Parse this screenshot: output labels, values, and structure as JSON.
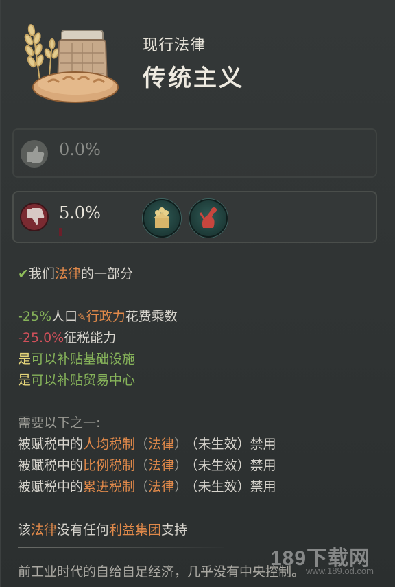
{
  "header": {
    "subtitle": "现行法律",
    "title": "传统主义"
  },
  "support": {
    "approve_value": "0.0%",
    "disapprove_value": "5.0%",
    "disapprove_groups": [
      "rural-folk-icon",
      "laborers-icon"
    ]
  },
  "status": {
    "part_of_prefix": "我们",
    "part_of_link": "法律",
    "part_of_suffix": "的一部分"
  },
  "effects": [
    {
      "value": "-25%",
      "text1": "人口",
      "link": "行政力",
      "text2": "花费乘数"
    },
    {
      "value": "-25.0%",
      "text": "征税能力"
    },
    {
      "yes": "是",
      "text": "可以补贴基础设施"
    },
    {
      "yes": "是",
      "text": "可以补贴贸易中心"
    }
  ],
  "requirements": {
    "heading": "需要以下之一:",
    "items": [
      {
        "pre": "被赋税",
        "mid": "中的",
        "law": "人均税制",
        "open": "（",
        "tag": "法律",
        "close": "）",
        "status": "（未生效）禁用"
      },
      {
        "pre": "被赋税",
        "mid": "中的",
        "law": "比例税制",
        "open": "（",
        "tag": "法律",
        "close": "）",
        "status": "（未生效）禁用"
      },
      {
        "pre": "被赋税",
        "mid": "中的",
        "law": "累进税制",
        "open": "（",
        "tag": "法律",
        "close": "）",
        "status": "（未生效）禁用"
      }
    ]
  },
  "interest": {
    "pre": "该",
    "law": "法律",
    "mid": "没有任何",
    "group": "利益集团",
    "post": "支持"
  },
  "footer": "前工业时代的自给自足经济，几乎没有中央控制。",
  "watermark": {
    "main": "189下载网",
    "sub": "www.189.od.com"
  },
  "colors": {
    "positive": "#86b35a",
    "negative": "#d0505a",
    "link": "#e0894a",
    "yes": "#e6d67a"
  }
}
